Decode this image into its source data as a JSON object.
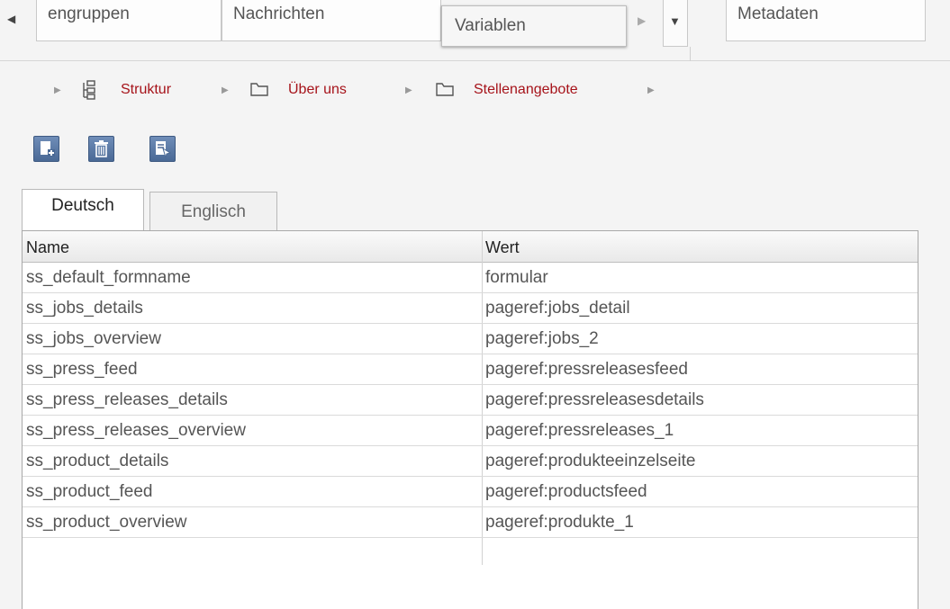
{
  "top_tabs": {
    "items": [
      "engruppen",
      "Nachrichten",
      "Variablen",
      "Metadaten"
    ],
    "active": "Variablen",
    "scroll_left_icon": "triangle-left-icon",
    "scroll_right_icon": "triangle-right-icon",
    "dropdown_icon": "chevron-down-icon"
  },
  "breadcrumb": {
    "items": [
      {
        "label": "Struktur",
        "icon": "structure-icon"
      },
      {
        "label": "Über uns",
        "icon": "folder-icon"
      },
      {
        "label": "Stellenangebote",
        "icon": "folder-icon"
      }
    ],
    "link_color": "#a6131a"
  },
  "toolbar": {
    "buttons": [
      {
        "icon": "add-document-icon"
      },
      {
        "icon": "trash-icon"
      },
      {
        "icon": "edit-document-icon"
      }
    ]
  },
  "language_tabs": {
    "items": [
      "Deutsch",
      "Englisch"
    ],
    "active": "Deutsch"
  },
  "table": {
    "columns": [
      "Name",
      "Wert"
    ],
    "rows": [
      [
        "ss_default_formname",
        "formular"
      ],
      [
        "ss_jobs_details",
        "pageref:jobs_detail"
      ],
      [
        "ss_jobs_overview",
        "pageref:jobs_2"
      ],
      [
        "ss_press_feed",
        "pageref:pressreleasesfeed"
      ],
      [
        "ss_press_releases_details",
        "pageref:pressreleasesdetails"
      ],
      [
        "ss_press_releases_overview",
        "pageref:pressreleases_1"
      ],
      [
        "ss_product_details",
        "pageref:produkteeinzelseite"
      ],
      [
        "ss_product_feed",
        "pageref:productsfeed"
      ],
      [
        "ss_product_overview",
        "pageref:produkte_1"
      ]
    ]
  }
}
